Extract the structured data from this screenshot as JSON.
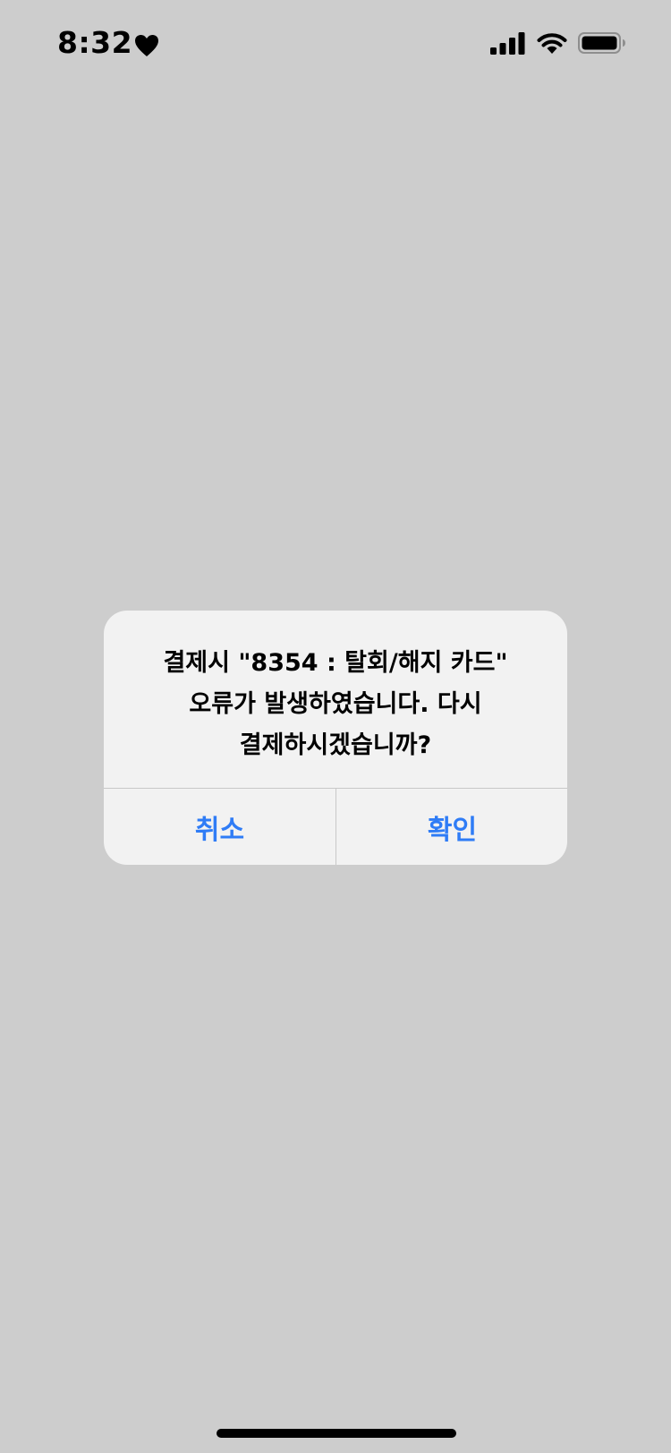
{
  "status_bar": {
    "time": "8:32",
    "icons": [
      "heart-icon",
      "cellular-signal-icon",
      "wifi-icon",
      "battery-icon"
    ]
  },
  "alert": {
    "message": "결제시 \"8354 : 탈회/해지 카드\"\n오류가 발생하였습니다. 다시\n결제하시겠습니까?",
    "cancel_label": "취소",
    "confirm_label": "확인"
  },
  "colors": {
    "background": "#cdcdcd",
    "alert_background": "#f2f2f2",
    "accent": "#2f7cf6"
  }
}
